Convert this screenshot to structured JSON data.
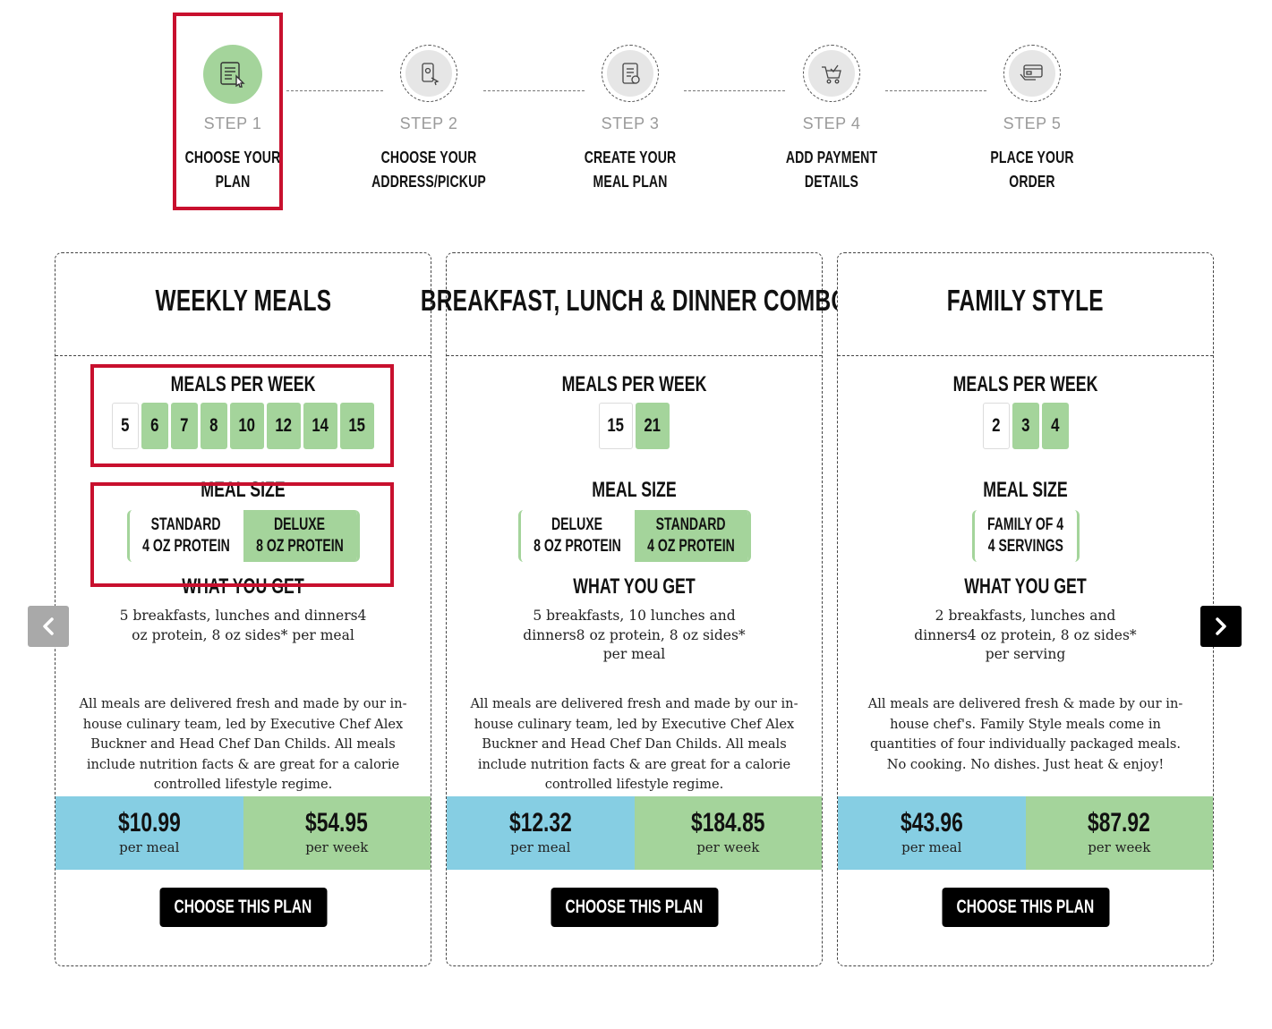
{
  "stepper": {
    "steps": [
      {
        "num": "STEP 1",
        "title_line1": "CHOOSE YOUR",
        "title_line2": "PLAN",
        "icon": "plan-calculator-icon"
      },
      {
        "num": "STEP 2",
        "title_line1": "CHOOSE YOUR",
        "title_line2": "ADDRESS/PICKUP",
        "icon": "phone-location-icon"
      },
      {
        "num": "STEP 3",
        "title_line1": "CREATE YOUR",
        "title_line2": "MEAL PLAN",
        "icon": "meal-checklist-icon"
      },
      {
        "num": "STEP 4",
        "title_line1": "ADD PAYMENT",
        "title_line2": "DETAILS",
        "icon": "cart-payment-icon"
      },
      {
        "num": "STEP 5",
        "title_line1": "PLACE YOUR",
        "title_line2": "ORDER",
        "icon": "credit-card-hand-icon"
      }
    ]
  },
  "labels": {
    "meals_per_week": "MEALS PER WEEK",
    "meal_size": "MEAL SIZE",
    "what_you_get": "WHAT YOU GET",
    "per_meal": "per meal",
    "per_week": "per week",
    "choose_button": "CHOOSE THIS PLAN"
  },
  "plans": [
    {
      "title": "WEEKLY MEALS",
      "meals_per_week": [
        "5",
        "6",
        "7",
        "8",
        "10",
        "12",
        "14",
        "15"
      ],
      "selected_meals": "5",
      "sizes": [
        {
          "line1": "STANDARD",
          "line2": "4 OZ PROTEIN",
          "active": false
        },
        {
          "line1": "DELUXE",
          "line2": "8 OZ PROTEIN",
          "active": true
        }
      ],
      "what_you_get": "5 breakfasts, lunches and dinners4 oz protein, 8 oz sides* per meal",
      "description": "All meals are delivered fresh and made by our in-house culinary team, led by Executive Chef Alex Buckner and Head Chef Dan Childs. All meals include nutrition facts & are great for a calorie controlled lifestyle regime.",
      "price_per_meal": "$10.99",
      "price_per_week": "$54.95"
    },
    {
      "title": "BREAKFAST, LUNCH & DINNER COMBO",
      "meals_per_week": [
        "15",
        "21"
      ],
      "selected_meals": "15",
      "sizes": [
        {
          "line1": "DELUXE",
          "line2": "8 OZ PROTEIN",
          "active": false
        },
        {
          "line1": "STANDARD",
          "line2": "4 OZ PROTEIN",
          "active": true
        }
      ],
      "what_you_get": "5 breakfasts, 10 lunches and dinners8 oz protein, 8 oz sides* per meal",
      "description": "All meals are delivered fresh and made by our in-house culinary team, led by Executive Chef Alex Buckner and Head Chef Dan Childs. All meals include nutrition facts & are great for a calorie controlled lifestyle regime.",
      "price_per_meal": "$12.32",
      "price_per_week": "$184.85"
    },
    {
      "title": "FAMILY STYLE",
      "meals_per_week": [
        "2",
        "3",
        "4"
      ],
      "selected_meals": "2",
      "sizes": [
        {
          "line1": "FAMILY OF 4",
          "line2": "4 SERVINGS",
          "active": false
        }
      ],
      "what_you_get": "2 breakfasts, lunches and dinners4 oz protein, 8 oz sides* per serving",
      "description": "All meals are delivered fresh & made by our in-house chef's. Family Style meals come in quantities of four individually packaged meals. No cooking. No dishes. Just heat & enjoy!",
      "price_per_meal": "$43.96",
      "price_per_week": "$87.92"
    }
  ],
  "colors": {
    "green": "#a4d49b",
    "blue": "#86cee3",
    "highlight_red": "#c8102e",
    "button_black": "#000000"
  }
}
